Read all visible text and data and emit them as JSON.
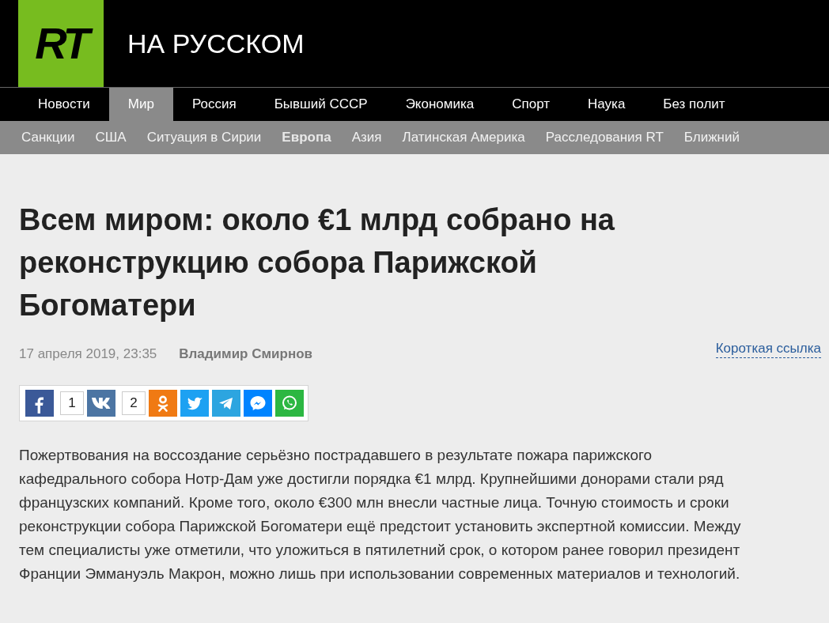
{
  "header": {
    "logo": "RT",
    "site_title": "НА РУССКОМ"
  },
  "nav": [
    {
      "label": "Новости",
      "selected": false
    },
    {
      "label": "Мир",
      "selected": true
    },
    {
      "label": "Россия",
      "selected": false
    },
    {
      "label": "Бывший СССР",
      "selected": false
    },
    {
      "label": "Экономика",
      "selected": false
    },
    {
      "label": "Спорт",
      "selected": false
    },
    {
      "label": "Наука",
      "selected": false
    },
    {
      "label": "Без полит",
      "selected": false
    }
  ],
  "subnav": [
    {
      "label": "Санкции",
      "selected": false
    },
    {
      "label": "США",
      "selected": false
    },
    {
      "label": "Ситуация в Сирии",
      "selected": false
    },
    {
      "label": "Европа",
      "selected": true
    },
    {
      "label": "Азия",
      "selected": false
    },
    {
      "label": "Латинская Америка",
      "selected": false
    },
    {
      "label": "Расследования RT",
      "selected": false
    },
    {
      "label": "Ближний",
      "selected": false
    }
  ],
  "article": {
    "title": "Всем миром: около €1 млрд собрано на реконструкцию собора Парижской Богоматери",
    "date": "17 апреля 2019, 23:35",
    "author": "Владимир Смирнов",
    "short_link": "Короткая ссылка",
    "share": [
      {
        "kind": "facebook",
        "count": "1"
      },
      {
        "kind": "vk",
        "count": "2"
      },
      {
        "kind": "ok"
      },
      {
        "kind": "twitter"
      },
      {
        "kind": "telegram"
      },
      {
        "kind": "messenger"
      },
      {
        "kind": "whatsapp"
      }
    ],
    "body": "Пожертвования на воссоздание серьёзно пострадавшего в результате пожара парижского кафедрального собора Нотр-Дам уже достигли порядка €1 млрд. Крупнейшими донорами стали ряд французских компаний. Кроме того, около €300 млн внесли частные лица. Точную стоимость и сроки реконструкции собора Парижской Богоматери ещё предстоит установить экспертной комиссии. Между тем специалисты уже отметили, что уложиться в пятилетний срок, о котором ранее говорил президент Франции Эммануэль Макрон, можно лишь при использовании современных материалов и технологий."
  }
}
